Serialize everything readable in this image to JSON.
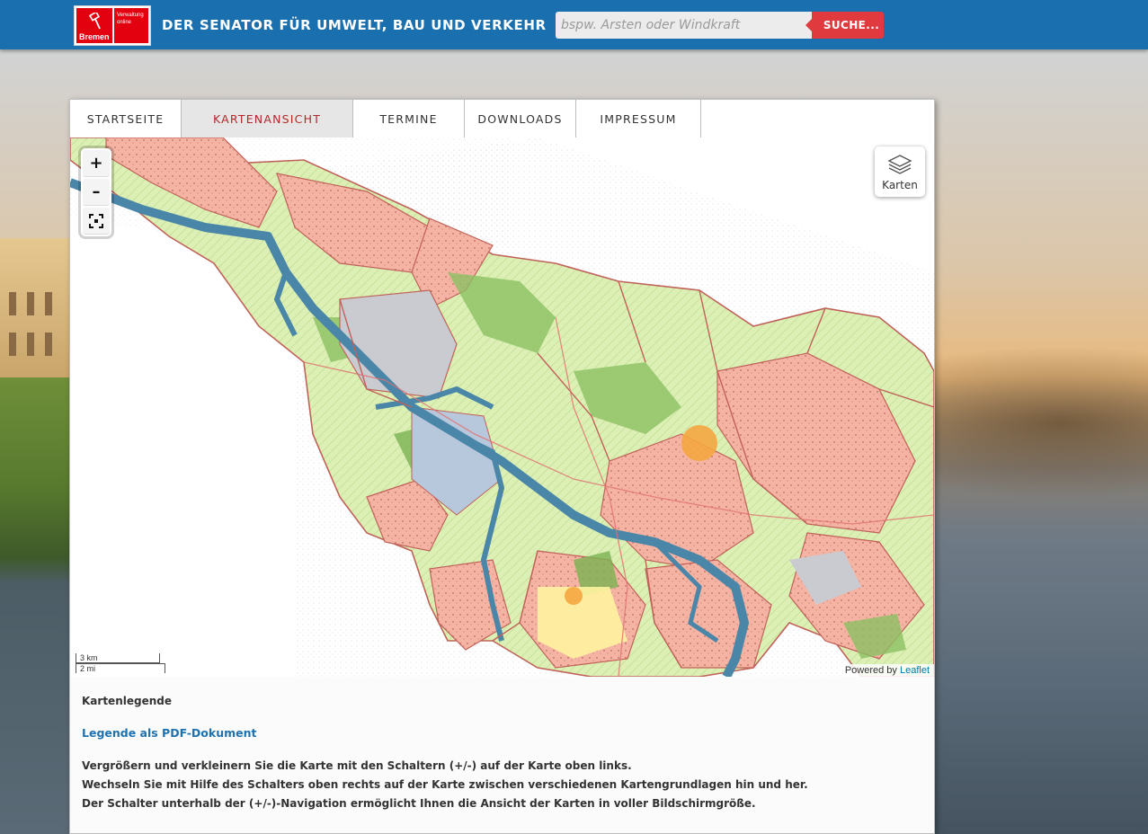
{
  "header": {
    "logo_text": "Bremen",
    "logo_subtext": "Verwaltung online",
    "title": "DER SENATOR FÜR UMWELT, BAU UND VERKEHR",
    "search_placeholder": "bspw. Arsten oder Windkraft",
    "search_button": "SUCHE..."
  },
  "nav": {
    "items": [
      {
        "label": "STARTSEITE",
        "active": false
      },
      {
        "label": "KARTENANSICHT",
        "active": true
      },
      {
        "label": "TERMINE",
        "active": false
      },
      {
        "label": "DOWNLOADS",
        "active": false
      },
      {
        "label": "IMPRESSUM",
        "active": false
      }
    ]
  },
  "map": {
    "zoom_in": "+",
    "zoom_out": "–",
    "fullscreen_icon": "fullscreen-icon",
    "layers_icon": "layers-icon",
    "layers_label": "Karten",
    "scale_metric": "3 km",
    "scale_imperial": "2 mi",
    "attribution_prefix": "Powered by",
    "attribution_link": "Leaflet"
  },
  "legend": {
    "title": "Kartenlegende",
    "pdf_link": "Legende als PDF-Dokument",
    "help_lines": [
      "Vergrößern und verkleinern Sie die Karte mit den Schaltern (+/-) auf der Karte oben links.",
      "Wechseln Sie mit Hilfe des Schalters oben rechts auf der Karte zwischen verschiedenen Kartengrundlagen hin und her.",
      "Der Schalter unterhalb der (+/-)-Navigation ermöglicht Ihnen die Ansicht der Karten in voller Bildschirmgröße."
    ]
  },
  "colors": {
    "header_blue": "#1a6fae",
    "search_red": "#e03a3e",
    "active_tab_text": "#b0282a",
    "link_blue": "#1f72b0",
    "map_residential": "#f5b3a3",
    "map_green": "#dbeeb4",
    "map_forest": "#8cc063",
    "map_water": "#4a86a8",
    "map_industrial": "#c9cbd1",
    "map_border": "#c0625a"
  }
}
